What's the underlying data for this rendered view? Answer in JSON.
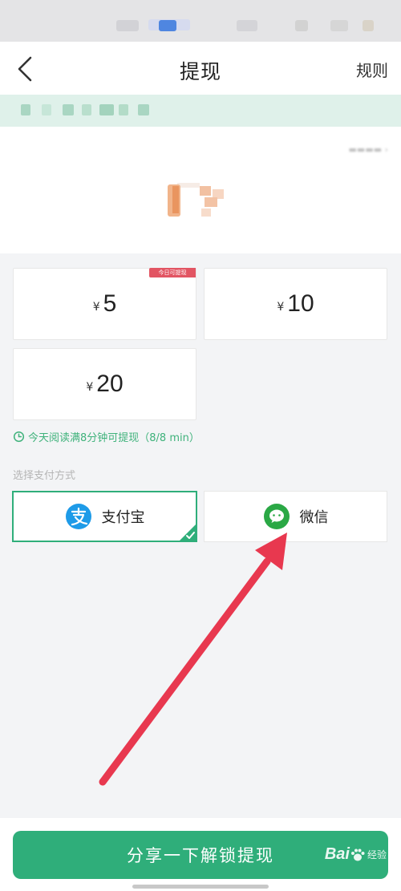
{
  "header": {
    "title": "提现",
    "rules_label": "规则"
  },
  "amounts": [
    {
      "yen": "¥",
      "value": "5",
      "badge": "今日可提现"
    },
    {
      "yen": "¥",
      "value": "10"
    },
    {
      "yen": "¥",
      "value": "20"
    }
  ],
  "read_tip": "今天阅读满8分钟可提现（8/8 min）",
  "payment": {
    "section_label": "选择支付方式",
    "options": [
      {
        "label": "支付宝",
        "icon": "alipay-icon",
        "selected": true
      },
      {
        "label": "微信",
        "icon": "wechat-icon",
        "selected": false
      }
    ]
  },
  "share_button_label": "分享一下解锁提现",
  "watermark": {
    "brand": "Bai",
    "suffix": "经验"
  },
  "colors": {
    "accent": "#2fae7a",
    "notice_bg": "#dff1ea",
    "badge_red": "#e25563",
    "arrow_red": "#e8384f",
    "alipay_blue": "#1e9be8",
    "wechat_green": "#2aa845"
  }
}
